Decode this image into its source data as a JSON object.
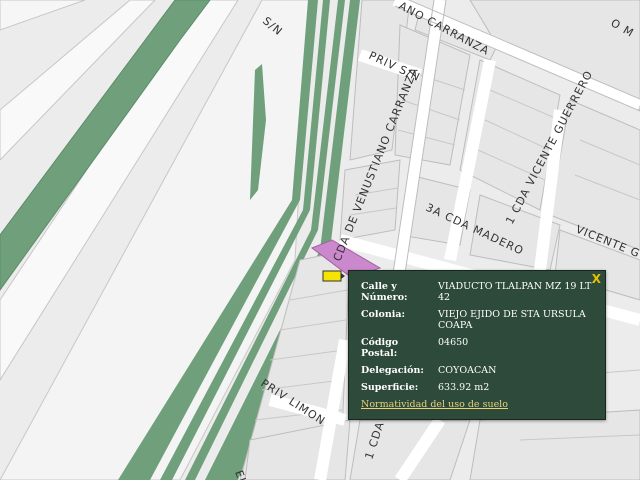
{
  "streets": {
    "sn": "S/N",
    "carranza_top": "ANO CARRANZA",
    "priv_sn": "PRIV S/N",
    "cda_venustiano": "CDA DE VENUSTIANO CARRANZA",
    "cda_madero": "3A CDA MADERO",
    "cda_vicente": "1 CDA VICENTE GUERRERO",
    "vicente_guerrero": "VICENTE GUE",
    "priv_limon": "PRIV LIMON",
    "cda_bottom": "1 CDA",
    "corner_top": "O M",
    "bottom_el": "EL"
  },
  "popup": {
    "fields": [
      {
        "label": "Calle y Número:",
        "value": "VIADUCTO TLALPAN MZ 19 LT 42"
      },
      {
        "label": "Colonia:",
        "value": "VIEJO EJIDO DE STA URSULA COAPA"
      },
      {
        "label": "Código Postal:",
        "value": "04650"
      },
      {
        "label": "Delegación:",
        "value": "COYOACAN"
      },
      {
        "label": "Superficie:",
        "value": "633.92 m2"
      }
    ],
    "close_label": "X",
    "link_label": "Normatividad del uso de suelo",
    "background": "#2e4a3a",
    "link_color": "#e8d27a"
  },
  "colors": {
    "green_area": "#6fa07b",
    "selected_parcel": "#cc88cc",
    "marker": "#f5e400"
  }
}
